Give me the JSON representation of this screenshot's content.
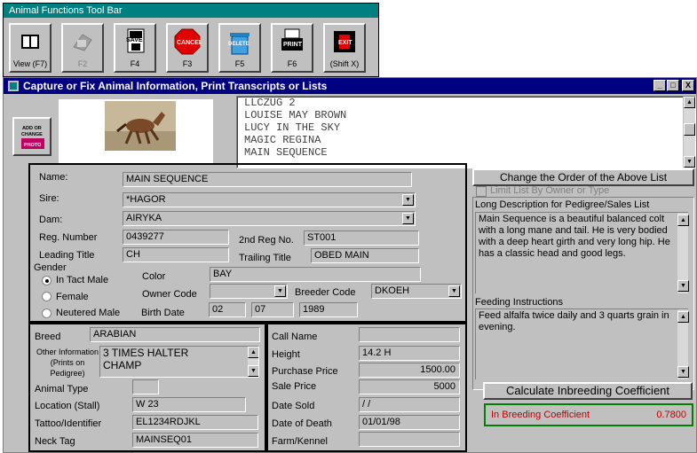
{
  "toolbar": {
    "title": "Animal Functions Tool Bar",
    "buttons": [
      {
        "label": "View (F7)",
        "icon": "view-icon"
      },
      {
        "label": "F2",
        "icon": "add-icon",
        "disabled": true
      },
      {
        "label": "F4",
        "icon": "save-icon",
        "icon_text": "SAVE"
      },
      {
        "label": "F3",
        "icon": "cancel-icon",
        "icon_text": "CANCEL"
      },
      {
        "label": "F5",
        "icon": "delete-icon",
        "icon_text": "DELETE"
      },
      {
        "label": "F6",
        "icon": "print-icon",
        "icon_text": "PRINT"
      },
      {
        "label": "(Shift X)",
        "icon": "exit-icon",
        "icon_text": "EXIT"
      }
    ]
  },
  "window": {
    "title": "Capture  or Fix Animal Information, Print Transcripts or Lists",
    "min": "_",
    "max": "□",
    "close": "X"
  },
  "photo_button": {
    "line1": "ADD OR",
    "line2": "CHANGE",
    "line3": "PHOTO"
  },
  "animal_list": [
    "LLCZUG 2",
    "LOUISE MAY BROWN",
    "LUCY IN THE SKY",
    "MAGIC REGINA",
    "MAIN SEQUENCE"
  ],
  "form": {
    "name_label": "Name:",
    "name": "MAIN SEQUENCE",
    "sire_label": "Sire:",
    "sire": "*HAGOR",
    "dam_label": "Dam:",
    "dam": "AIRYKA",
    "reg_label": "Reg. Number",
    "reg": "0439277",
    "reg2_label": "2nd Reg No.",
    "reg2": "ST001",
    "leading_label": "Leading Title",
    "leading": "CH",
    "trailing_label": "Trailing Title",
    "trailing": "OBED MAIN",
    "gender_label": "Gender",
    "gender_options": [
      "In Tact Male",
      "Female",
      "Neutered Male"
    ],
    "color_label": "Color",
    "color": "BAY",
    "owner_label": "Owner Code",
    "owner": "",
    "breeder_label": "Breeder Code",
    "breeder": "DKOEH",
    "birth_label": "Birth Date",
    "birth_m": "02",
    "birth_d": "07",
    "birth_y": "1989"
  },
  "details": {
    "breed_label": "Breed",
    "breed": "ARABIAN",
    "other_label1": "Other Information",
    "other_label2": "(Prints on",
    "other_label3": "Pedigree)",
    "other": "3 TIMES HALTER CHAMP",
    "type_label": "Animal Type",
    "type": "",
    "location_label": "Location (Stall)",
    "location": "W 23",
    "tattoo_label": "Tattoo/Identifier",
    "tattoo": "EL1234RDJKL",
    "neck_label": "Neck Tag",
    "neck": "MAINSEQ01"
  },
  "sales": {
    "callname_label": "Call Name",
    "callname": "",
    "height_label": "Height",
    "height": "14.2 H",
    "purchase_label": "Purchase Price",
    "purchase": "1500.00",
    "sale_label": "Sale Price",
    "sale": "5000",
    "datesold_label": "Date Sold",
    "datesold": "/ /",
    "death_label": "Date of Death",
    "death": "01/01/98",
    "farm_label": "Farm/Kennel",
    "farm": ""
  },
  "right": {
    "change_order": "Change the Order of the Above List",
    "limit_list": "Limit List By Owner or Type",
    "long_desc_label": "Long Description for Pedigree/Sales List",
    "long_desc": "Main Sequence is a beautiful balanced colt with a long mane and tail.  He is very bodied with a deep heart girth and very long hip.  He has a classic head and good legs.",
    "feeding_label": "Feeding Instructions",
    "feeding": "Feed alfalfa twice daily and 3 quarts grain in evening.",
    "calc_button": "Calculate Inbreeding Coefficient",
    "ibc_label": "In Breeding Coefficient",
    "ibc_value": "0.7800"
  },
  "colors": {
    "titlebar": "#000080",
    "toolbar_title": "#008080",
    "ibc_border": "#008000",
    "ibc_text": "#c00000"
  }
}
